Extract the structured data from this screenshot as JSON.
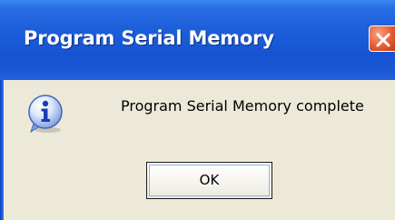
{
  "dialog": {
    "title": "Program Serial Memory",
    "message": "Program Serial Memory complete",
    "ok_label": "OK",
    "icon": "info-icon"
  },
  "colors": {
    "titlebar": "#1653d2",
    "body": "#ece9d8",
    "close_button": "#d2461e"
  }
}
